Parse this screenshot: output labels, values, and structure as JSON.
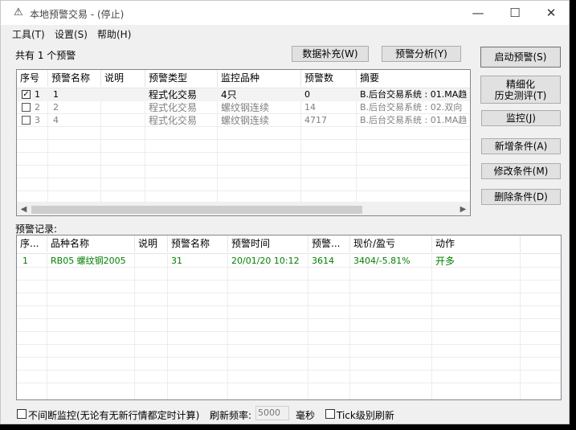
{
  "window": {
    "icon": "alarm-icon",
    "title": "本地预警交易 - (停止)",
    "controls": {
      "minimize": "—",
      "maximize": "☐",
      "close": "✕"
    }
  },
  "menu": [
    "工具(T)",
    "设置(S)",
    "帮助(H)"
  ],
  "summary": "共有 1 个预警",
  "top_buttons": {
    "data_fill": "数据补充(W)",
    "analysis": "预警分析(Y)"
  },
  "warnings_table": {
    "columns": [
      "序号",
      "预警名称",
      "说明",
      "预警类型",
      "监控品种",
      "预警数",
      "摘要"
    ],
    "rows": [
      {
        "checked": true,
        "cells": [
          "1",
          "1",
          "",
          "程式化交易",
          "4只",
          "0",
          "B.后台交易系统 : 01.MA趋"
        ],
        "muted": false
      },
      {
        "checked": false,
        "cells": [
          "2",
          "2",
          "",
          "程式化交易",
          "螺纹钢连续",
          "14",
          "B.后台交易系统 : 02.双向"
        ],
        "muted": true
      },
      {
        "checked": false,
        "cells": [
          "3",
          "4",
          "",
          "程式化交易",
          "螺纹钢连续",
          "4717",
          "B.后台交易系统 : 01.MA趋"
        ],
        "muted": true
      }
    ]
  },
  "side_buttons": {
    "start": "启动预警(S)",
    "refine_line1": "精细化",
    "refine_line2": "历史测评(T)",
    "monitor": "监控(J)",
    "add": "新增条件(A)",
    "modify": "修改条件(M)",
    "delete": "删除条件(D)"
  },
  "records_label": "预警记录:",
  "records_table": {
    "columns": [
      "序...",
      "品种名称",
      "说明",
      "预警名称",
      "预警时间",
      "预警...",
      "现价/盈亏",
      "动作"
    ],
    "rows": [
      {
        "cells": [
          "1",
          "RB05 螺纹钢2005",
          "",
          "31",
          "20/01/20 10:12",
          "3614",
          "3404/-5.81%",
          "开多"
        ]
      }
    ]
  },
  "footer": {
    "continuous_label": "不间断监控(无论有无新行情都定时计算)",
    "continuous_checked": false,
    "refresh_label": "刷新频率:",
    "refresh_value": "5000",
    "unit": "毫秒",
    "tick_label": "Tick级别刷新",
    "tick_checked": false
  },
  "colors": {
    "record_text": "#008000",
    "muted_text": "#808080",
    "window_bg": "#f0f0f0"
  }
}
